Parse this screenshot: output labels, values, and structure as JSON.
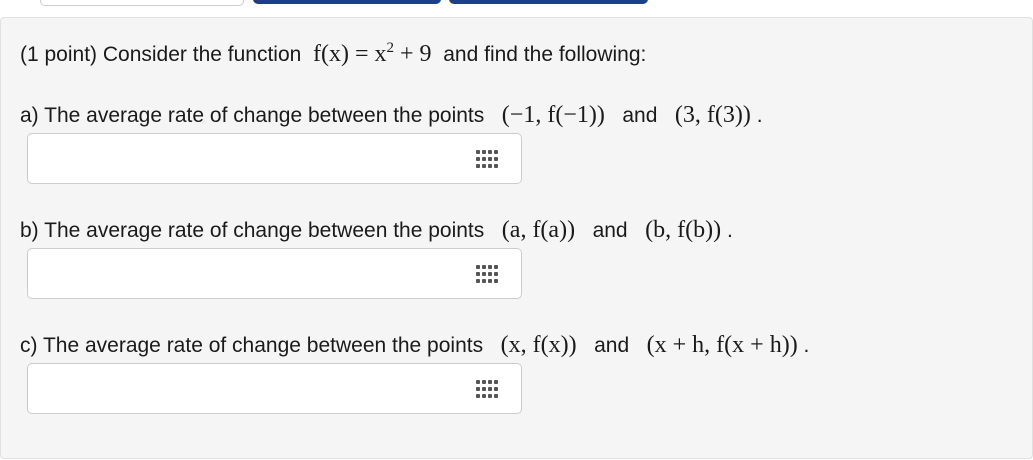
{
  "problem": {
    "intro": "(1 point) Consider the function",
    "function_expr": "f(x) = x",
    "exponent": "2",
    "function_tail": " + 9",
    "intro_end": "and find the following:"
  },
  "parts": [
    {
      "text": "a) The average rate of change between the points",
      "point1": "(−1, f(−1))",
      "and": "and",
      "point2": "(3, f(3))",
      "period": ".",
      "answer_value": ""
    },
    {
      "text": "b) The average rate of change between the points",
      "point1": "(a, f(a))",
      "and": "and",
      "point2": "(b, f(b))",
      "period": ".",
      "answer_value": ""
    },
    {
      "text": "c) The average rate of change between the points",
      "point1": "(x, f(x))",
      "and": "and",
      "point2": "(x + h, f(x + h))",
      "period": ".",
      "answer_value": ""
    }
  ],
  "icons": {
    "equation_editor": "keyboard-grid-icon"
  },
  "colors": {
    "tab_blue": "#1c3f8c",
    "panel_bg": "#f5f5f5"
  }
}
